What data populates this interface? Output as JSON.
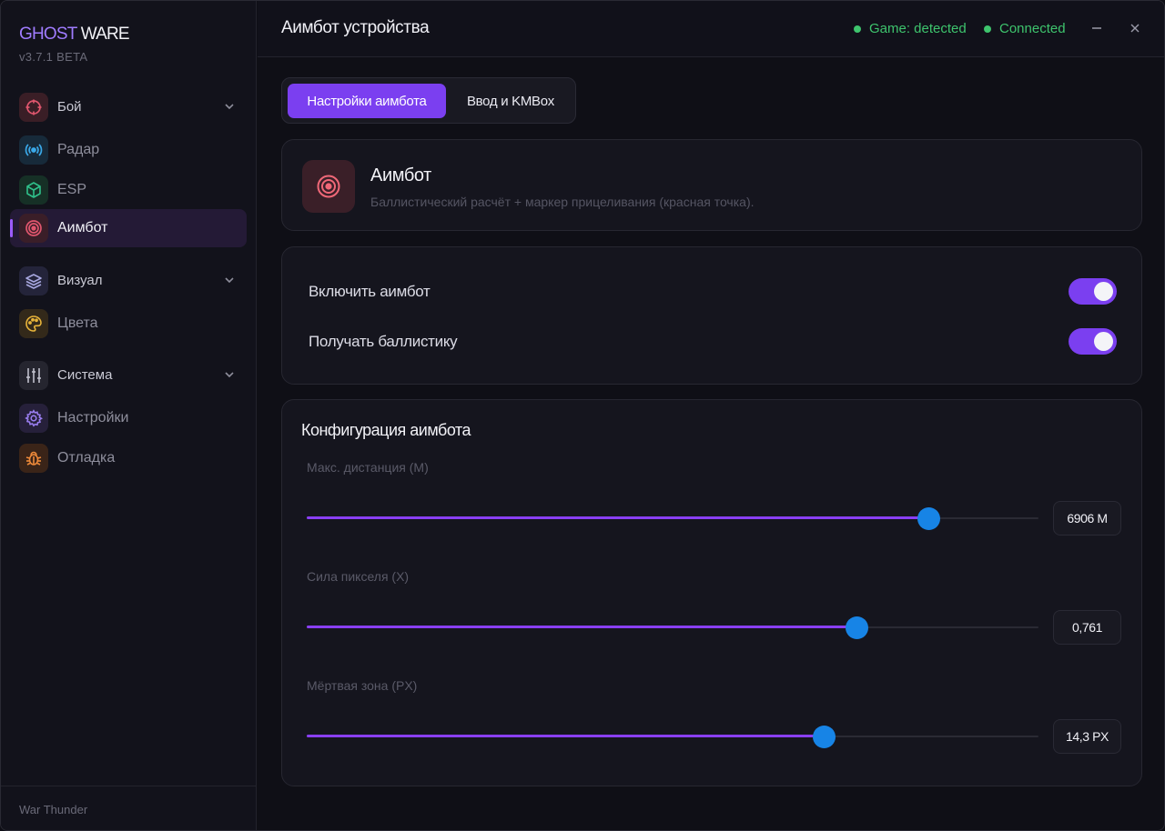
{
  "app": {
    "brand_part1": "GHOST",
    "brand_part2": "WARE",
    "version": "v3.7.1 BETA"
  },
  "sidebar": {
    "items": [
      {
        "label": "Бой",
        "icon": "crosshair-icon",
        "color": "#e0566e",
        "bg": "#3a1e26",
        "group": true
      },
      {
        "label": "Радар",
        "icon": "radar-icon",
        "color": "#3aa8e8",
        "bg": "#172a3a"
      },
      {
        "label": "ESP",
        "icon": "cube-icon",
        "color": "#2fc08a",
        "bg": "#163026"
      },
      {
        "label": "Аимбот",
        "icon": "target-icon",
        "color": "#e0566e",
        "bg": "#3a1e28",
        "active": true
      },
      {
        "label": "Визуал",
        "icon": "layers-icon",
        "color": "#8a8ae6",
        "bg": "#24243a",
        "group": true
      },
      {
        "label": "Цвета",
        "icon": "palette-icon",
        "color": "#e8b43a",
        "bg": "#33291a"
      },
      {
        "label": "Система",
        "icon": "sliders-icon",
        "color": "#b8b8c8",
        "bg": "#25252f",
        "group": true
      },
      {
        "label": "Настройки",
        "icon": "gear-icon",
        "color": "#9a7ef0",
        "bg": "#26203a"
      },
      {
        "label": "Отладка",
        "icon": "bug-icon",
        "color": "#ee8a3a",
        "bg": "#3a2418"
      }
    ],
    "footer": "War Thunder"
  },
  "header": {
    "title": "Аимбот устройства",
    "status_game": "Game: detected",
    "status_connection": "Connected",
    "status_color": "#3ec46d"
  },
  "tabs": [
    {
      "label": "Настройки аимбота",
      "active": true
    },
    {
      "label": "Ввод и KMBox",
      "active": false
    }
  ],
  "hero": {
    "title": "Аимбот",
    "subtitle": "Баллистический расчёт + маркер прицеливания (красная точка).",
    "icon": "target-icon"
  },
  "toggles": [
    {
      "label": "Включить аимбот",
      "on": true
    },
    {
      "label": "Получать баллистику",
      "on": true
    }
  ],
  "config": {
    "title": "Конфигурация аимбота",
    "sliders": [
      {
        "label": "Макс. дистанция (М)",
        "value": "6906 M",
        "fraction": 0.849
      },
      {
        "label": "Сила пикселя (X)",
        "value": "0,761",
        "fraction": 0.751
      },
      {
        "label": "Мёртвая зона (PX)",
        "value": "14,3 PX",
        "fraction": 0.706
      }
    ]
  },
  "accent": "#7b3ff0",
  "slider_thumb_color": "#1784e6"
}
